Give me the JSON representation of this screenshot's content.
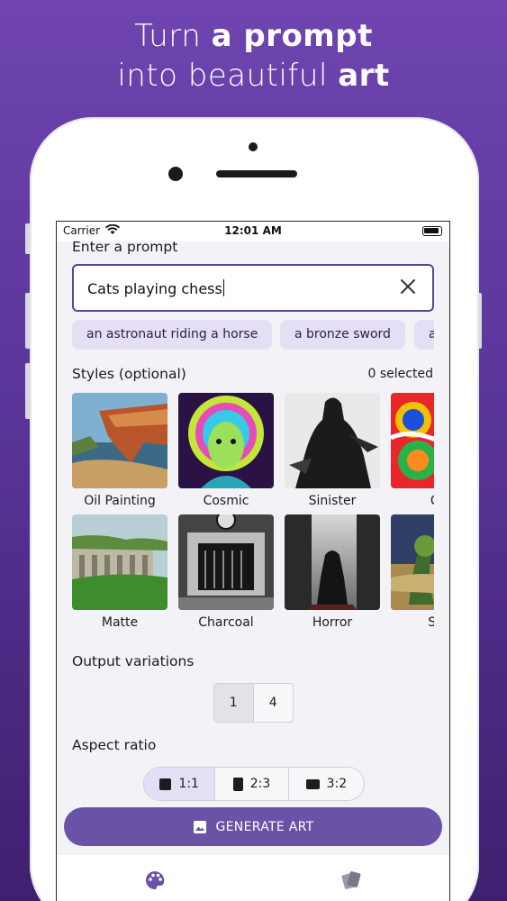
{
  "headline": {
    "line1_pre": "Turn ",
    "line1_bold": "a prompt",
    "line2_pre": "into beautiful ",
    "line2_bold": "art"
  },
  "status_bar": {
    "carrier": "Carrier",
    "time": "12:01 AM"
  },
  "prompt": {
    "title": "Enter a prompt",
    "value": "Cats playing chess",
    "suggestions": [
      "an astronaut riding a horse",
      "a bronze sword",
      "a"
    ]
  },
  "styles": {
    "title": "Styles (optional)",
    "selected_count": "0 selected",
    "items": [
      "Oil Painting",
      "Cosmic",
      "Sinister",
      "Ca",
      "Matte",
      "Charcoal",
      "Horror",
      "Sur"
    ]
  },
  "output_variations": {
    "title": "Output variations",
    "options": [
      "1",
      "4"
    ],
    "selected": "1"
  },
  "aspect_ratio": {
    "title": "Aspect ratio",
    "options": [
      "1:1",
      "2:3",
      "3:2"
    ],
    "selected": "1:1"
  },
  "generate_button": {
    "label": "GENERATE ART"
  },
  "colors": {
    "accent": "#6a53a6",
    "chip_bg": "#e5dff5",
    "background_top": "#6f44b0"
  }
}
